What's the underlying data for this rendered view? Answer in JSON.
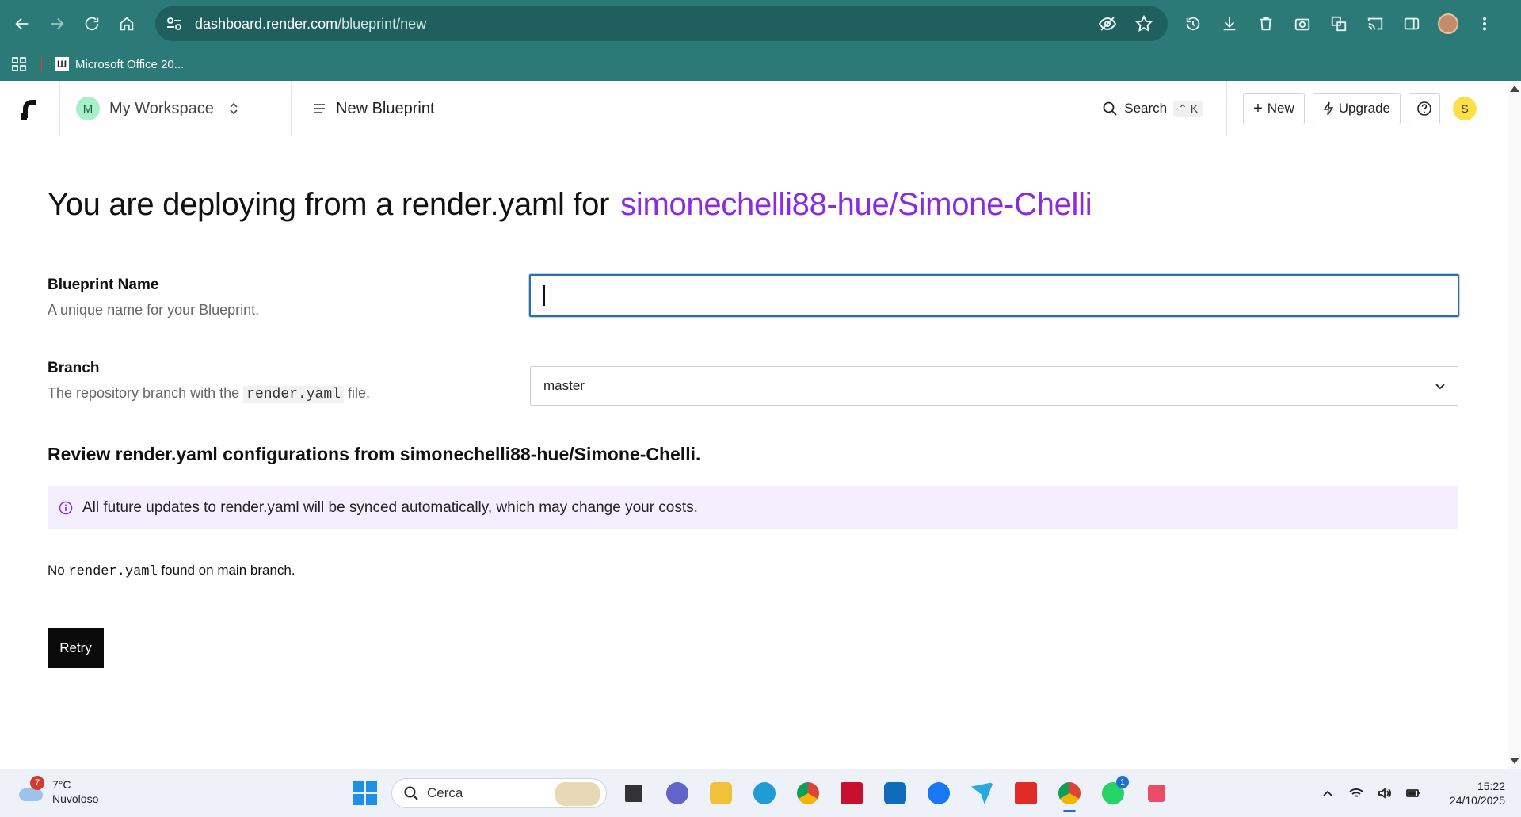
{
  "browser": {
    "url_host": "dashboard.render.com",
    "url_path": "/blueprint/new",
    "bookmark": "Microsoft Office 20..."
  },
  "header": {
    "workspace_initial": "M",
    "workspace_name": "My Workspace",
    "page_title": "New Blueprint",
    "search_label": "Search",
    "search_shortcut": "⌃ K",
    "new_label": "New",
    "upgrade_label": "Upgrade",
    "user_initial": "S"
  },
  "main": {
    "headline_prefix": "You are deploying from a render.yaml for",
    "repo": "simonechelli88-hue/Simone-Chelli",
    "name_field": {
      "label": "Blueprint Name",
      "help": "A unique name for your Blueprint.",
      "value": ""
    },
    "branch_field": {
      "label": "Branch",
      "help_before": "The repository branch with the",
      "help_code": "render.yaml",
      "help_after": "file.",
      "selected": "master"
    },
    "review_heading": "Review render.yaml configurations from simonechelli88-hue/Simone-Chelli.",
    "notice": {
      "before": "All future updates to",
      "link": "render.yaml",
      "after": "will be synced automatically, which may change your costs."
    },
    "status": {
      "before": "No",
      "code": "render.yaml",
      "after": "found on main branch."
    },
    "retry_label": "Retry"
  },
  "taskbar": {
    "weather_badge": "7",
    "temperature": "7°C",
    "condition": "Nuvoloso",
    "search_placeholder": "Cerca",
    "whatsapp_badge": "1",
    "time": "15:22",
    "date": "24/10/2025"
  },
  "colors": {
    "chrome": "#2b7a78",
    "repo_accent": "#8a2be2",
    "notice_bg": "#f4efff",
    "input_focus": "#2f6fa8"
  }
}
